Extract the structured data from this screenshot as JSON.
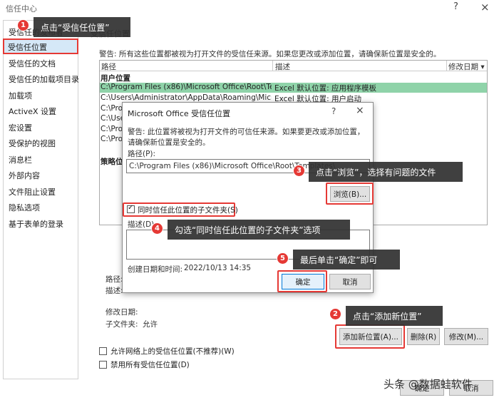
{
  "window": {
    "title": "信任中心",
    "help": "?",
    "close": "×"
  },
  "sidebar": {
    "items": [
      {
        "label": "受信任的发布者"
      },
      {
        "label": "受信任位置"
      },
      {
        "label": "受信任的文档"
      },
      {
        "label": "受信任的加载项目录"
      },
      {
        "label": "加载项"
      },
      {
        "label": "ActiveX 设置"
      },
      {
        "label": "宏设置"
      },
      {
        "label": "受保护的视图"
      },
      {
        "label": "消息栏"
      },
      {
        "label": "外部内容"
      },
      {
        "label": "文件阻止设置"
      },
      {
        "label": "隐私选项"
      },
      {
        "label": "基于表单的登录"
      }
    ]
  },
  "main": {
    "heading": "受信任位置",
    "warning": "警告: 所有这些位置都被视为打开文件的受信任来源。如果您更改或添加位置，请确保新位置是安全的。",
    "table": {
      "col_path": "路径",
      "col_desc": "描述",
      "col_date": "修改日期 ▾",
      "group_user": "用户位置",
      "group_policy": "策略位置",
      "rows": [
        {
          "path": "C:\\Program Files (x86)\\Microsoft Office\\Root\\Te",
          "desc": "Excel 默认位置: 应用程序模板"
        },
        {
          "path": "C:\\Users\\Administrator\\AppData\\Roaming\\Micr",
          "desc": "Excel 默认位置: 用户启动"
        },
        {
          "path": "C:\\Prog",
          "desc": ""
        },
        {
          "path": "C:\\Use",
          "desc": ""
        },
        {
          "path": "C:\\Prog",
          "desc": ""
        },
        {
          "path": "C:\\Prog",
          "desc": ""
        }
      ]
    },
    "details": {
      "path_label": "路径:",
      "desc_label": "描述:",
      "date_label": "修改日期:",
      "subfolder_label": "子文件夹:",
      "subfolder_value": "允许"
    },
    "buttons": {
      "add": "添加新位置(A)...",
      "remove": "删除(R)",
      "modify": "修改(M)..."
    },
    "checkboxes": {
      "allow_network": "允许网络上的受信任位置(不推荐)(W)",
      "disable_all": "禁用所有受信任位置(D)"
    },
    "footer": {
      "ok": "确定",
      "cancel": "取消"
    }
  },
  "dialog": {
    "title": "Microsoft Office 受信任位置",
    "help": "?",
    "close": "×",
    "warning": "警告: 此位置将被视为打开文件的可信任来源。如果要更改或添加位置，请确保新位置是安全的。",
    "path_label": "路径(P):",
    "path_value": "C:\\Program Files (x86)\\Microsoft Office\\Root\\Templates\\",
    "browse": "浏览(B)...",
    "subfolders_label": "同时信任此位置的子文件夹(S)",
    "subfolders_checked": true,
    "desc_label": "描述(D):",
    "created_label": "创建日期和时间:",
    "created_value": "2022/10/13 14:35",
    "ok": "确定",
    "cancel": "取消"
  },
  "annotations": [
    {
      "num": "1",
      "text": "点击“受信任位置”"
    },
    {
      "num": "2",
      "text": "点击“添加新位置”"
    },
    {
      "num": "3",
      "text": "点击“浏览”，选择有问题的文件"
    },
    {
      "num": "4",
      "text": "勾选“同时信任此位置的子文件夹”选项"
    },
    {
      "num": "5",
      "text": "最后单击“确定”即可"
    }
  ],
  "watermark": "头条 @数据蛙软件",
  "colors": {
    "highlight_red": "#e53935",
    "selected_row": "#8fd3a9",
    "sidebar_selected": "#d5e8f7",
    "callout_bg": "#303030"
  }
}
